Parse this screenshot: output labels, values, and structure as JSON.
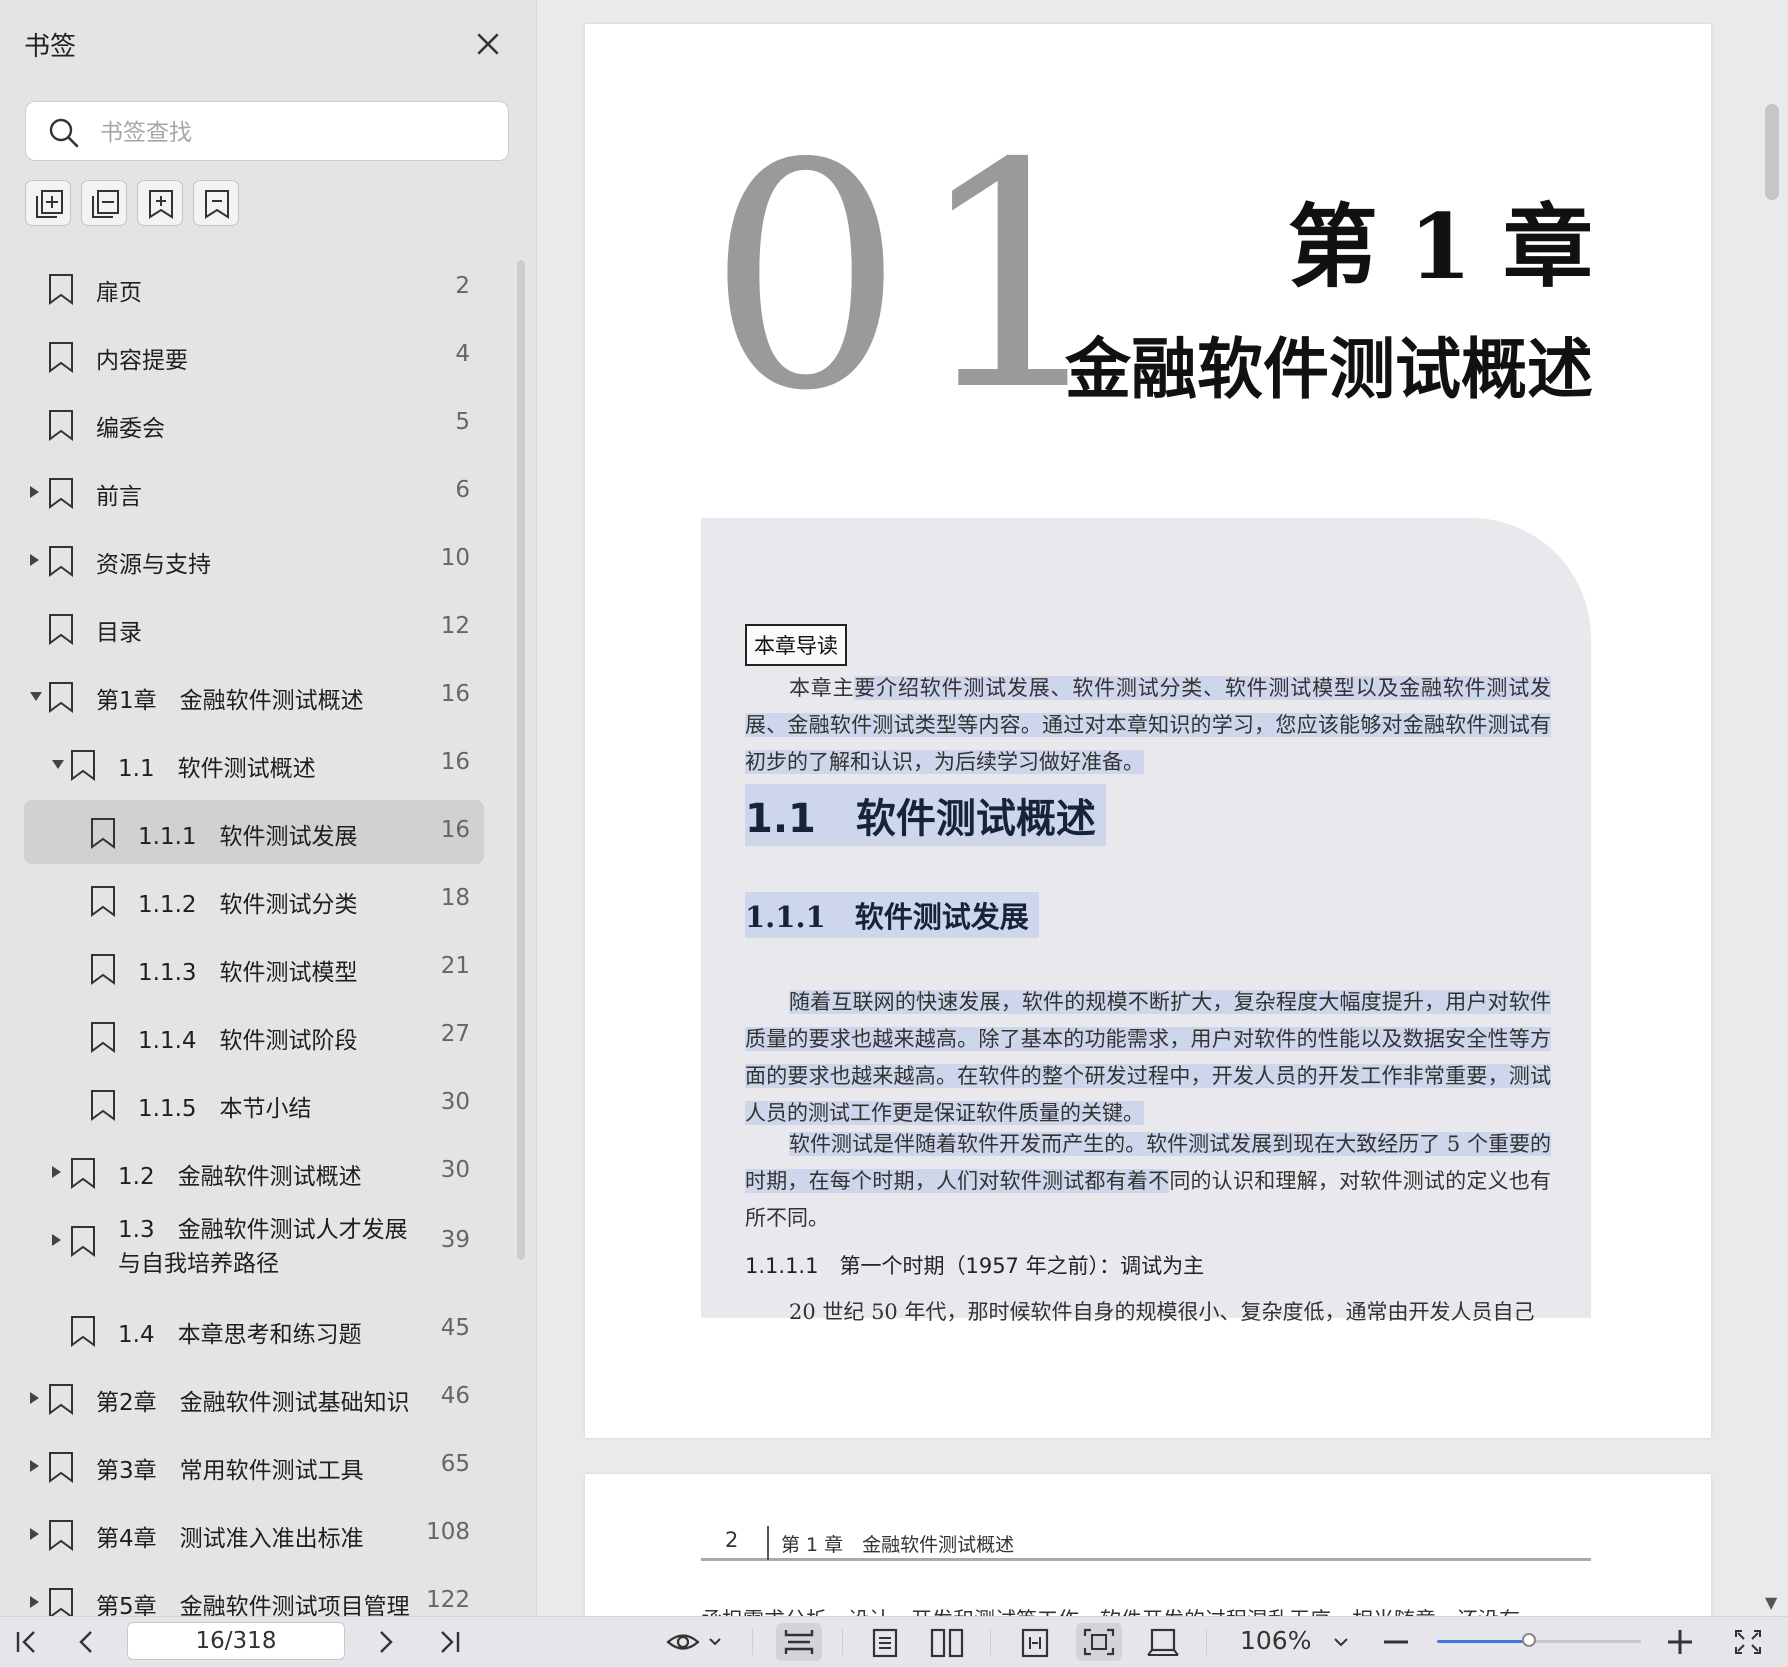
{
  "sidebar": {
    "title": "书签",
    "search_placeholder": "书签查找",
    "bookmarks": [
      {
        "label": "扉页",
        "page": "2",
        "level": 0,
        "expand": "none",
        "selected": false
      },
      {
        "label": "内容提要",
        "page": "4",
        "level": 0,
        "expand": "none",
        "selected": false
      },
      {
        "label": "编委会",
        "page": "5",
        "level": 0,
        "expand": "none",
        "selected": false
      },
      {
        "label": "前言",
        "page": "6",
        "level": 0,
        "expand": "collapsed",
        "selected": false
      },
      {
        "label": "资源与支持",
        "page": "10",
        "level": 0,
        "expand": "collapsed",
        "selected": false
      },
      {
        "label": "目录",
        "page": "12",
        "level": 0,
        "expand": "none",
        "selected": false
      },
      {
        "label": "第1章　金融软件测试概述",
        "page": "16",
        "level": 0,
        "expand": "expanded",
        "selected": false
      },
      {
        "label": "1.1　软件测试概述",
        "page": "16",
        "level": 1,
        "expand": "expanded",
        "selected": false
      },
      {
        "label": "1.1.1　软件测试发展",
        "page": "16",
        "level": 2,
        "expand": "none",
        "selected": true
      },
      {
        "label": "1.1.2　软件测试分类",
        "page": "18",
        "level": 2,
        "expand": "none",
        "selected": false
      },
      {
        "label": "1.1.3　软件测试模型",
        "page": "21",
        "level": 2,
        "expand": "none",
        "selected": false
      },
      {
        "label": "1.1.4　软件测试阶段",
        "page": "27",
        "level": 2,
        "expand": "none",
        "selected": false
      },
      {
        "label": "1.1.5　本节小结",
        "page": "30",
        "level": 2,
        "expand": "none",
        "selected": false
      },
      {
        "label": "1.2　金融软件测试概述",
        "page": "30",
        "level": 1,
        "expand": "collapsed",
        "selected": false
      },
      {
        "label": "1.3　金融软件测试人才发展",
        "label2": "与自我培养路径",
        "page": "39",
        "level": 1,
        "expand": "collapsed",
        "selected": false
      },
      {
        "label": "1.4　本章思考和练习题",
        "page": "45",
        "level": 1,
        "expand": "none",
        "selected": false
      },
      {
        "label": "第2章　金融软件测试基础知识",
        "page": "46",
        "level": 0,
        "expand": "collapsed",
        "selected": false
      },
      {
        "label": "第3章　常用软件测试工具",
        "page": "65",
        "level": 0,
        "expand": "collapsed",
        "selected": false
      },
      {
        "label": "第4章　测试准入准出标准",
        "page": "108",
        "level": 0,
        "expand": "collapsed",
        "selected": false
      },
      {
        "label": "第5章　金融软件测试项目管理",
        "page": "122",
        "level": 0,
        "expand": "collapsed",
        "selected": false
      }
    ]
  },
  "document": {
    "page1": {
      "chapter_number": "01",
      "chapter_label": "第 1 章",
      "chapter_title": "金融软件测试概述",
      "guide_tag": "本章导读",
      "intro_plain": "本章主",
      "intro_highlight": "要介绍软件测试发展、软件测试分类、软件测试模型以及金融软件测试发展、金融软件测试类型等内容。通过对本章知识的学习，您应该能够对金融软件测试有初步的了解和认识，为后续学习做好准备。",
      "section_heading": "1.1　软件测试概述",
      "subsection_heading": "1.1.1　软件测试发展",
      "para1": "随着互联网的快速发展，软件的规模不断扩大，复杂程度大幅度提升，用户对软件质量的要求也越来越高。除了基本的功能需求，用户对软件的性能以及数据安全性等方面的要求也越来越高。在软件的整个研发过程中，开发人员的开发工作非常重要，测试人员的测试工作更是保证软件质量的关键。",
      "para2_highlight": "软件测试是伴随着软件开发而产生的。软件测试发展到现在大致经历了 5 个重要的时期，在每个时期，人们对软件测试都有着不",
      "para2_plain": "同的认识和理解，对软件测试的定义也有所不同。",
      "subsubsection_heading": "1.1.1.1　第一个时期（1957 年之前）：调试为主",
      "para3": "20 世纪 50 年代，那时候软件自身的规模很小、复杂度低，通常由开发人员自己"
    },
    "page2": {
      "page_number": "2",
      "running_header": "第 1 章　金融软件测试概述",
      "first_line": "承担需求分析、设计、开发和测试等工作。软件开发的过程混乱无序，相当随意，还没有"
    }
  },
  "toolbar": {
    "page_indicator": "16/318",
    "zoom": "106%",
    "zoom_fraction": 0.45
  }
}
